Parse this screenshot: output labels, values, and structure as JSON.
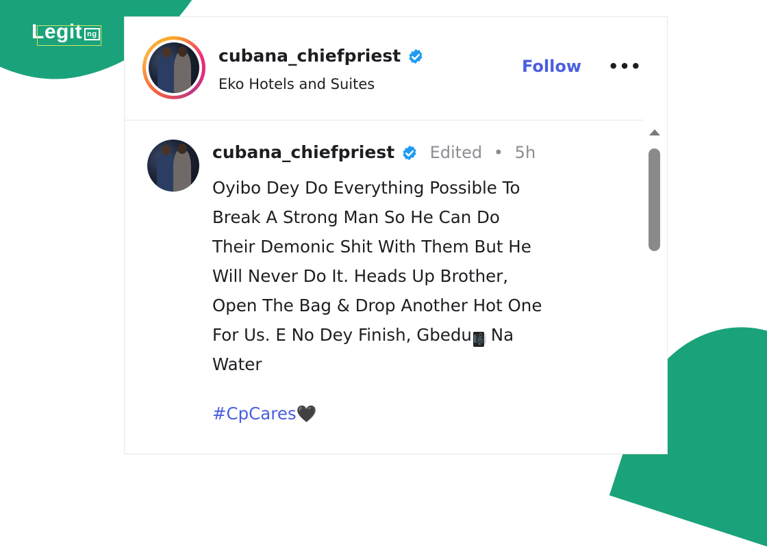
{
  "brand": {
    "logo_text": "Legit",
    "logo_tld": "ng",
    "color": "#1aa37a"
  },
  "post": {
    "account": {
      "username": "cubana_chiefpriest",
      "verified": true,
      "location": "Eko Hotels and Suites"
    },
    "actions": {
      "follow_label": "Follow",
      "more_label": "•••"
    }
  },
  "comment": {
    "username": "cubana_chiefpriest",
    "verified": true,
    "edited_label": "Edited",
    "separator": "•",
    "time": "5h",
    "caption_line1": "Oyibo Dey Do Everything Possible To",
    "caption_line2": "Break A Strong Man So He Can Do",
    "caption_line3": "Their Demonic Shit With Them But He",
    "caption_line4": "Will Never Do It. Heads Up Brother,",
    "caption_line5": "Open The Bag & Drop Another Hot One",
    "caption_line6_before": "For Us. E No Dey Finish, Gbedu",
    "caption_line6_emoji": "🎼",
    "caption_line6_after": " Na",
    "caption_line7": "Water",
    "hashtag": "#CpCares",
    "hashtag_emoji": "🖤"
  },
  "colors": {
    "link": "#4a5fe0",
    "verified": "#1d9bf0",
    "muted": "#8a8d91"
  }
}
